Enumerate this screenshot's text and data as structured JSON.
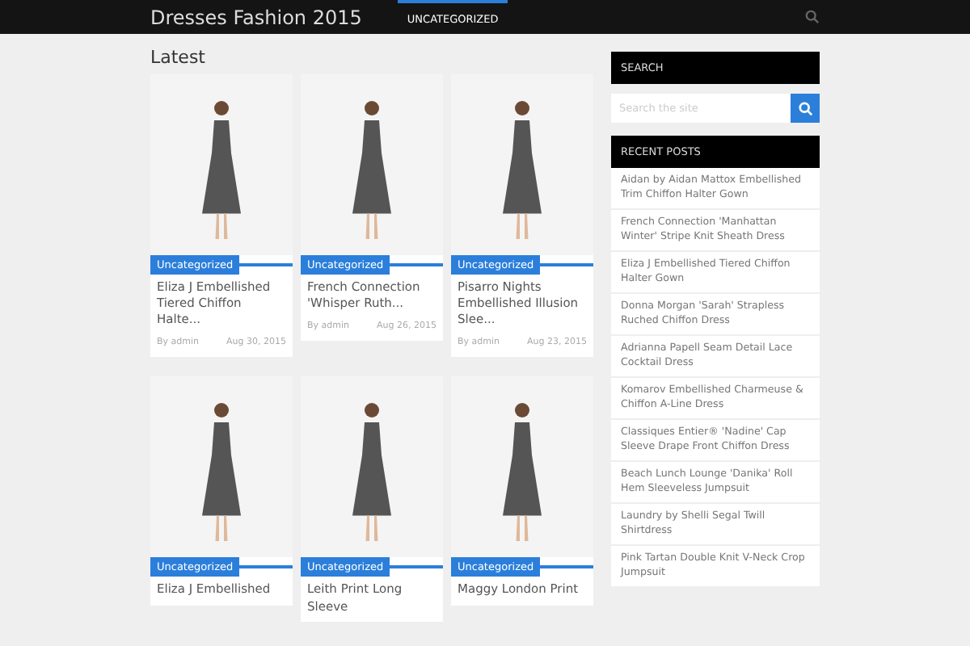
{
  "header": {
    "site_title": "Dresses Fashion 2015",
    "nav": [
      {
        "label": "UNCATEGORIZED",
        "selected": true
      }
    ]
  },
  "section_title": "Latest",
  "posts": [
    {
      "category": "Uncategorized",
      "title": "Eliza J Embellished Tiered Chiffon Halte...",
      "author": "By admin",
      "date": "Aug 30, 2015"
    },
    {
      "category": "Uncategorized",
      "title": "French Connection 'Whisper Ruth...",
      "author": "By admin",
      "date": "Aug 26, 2015"
    },
    {
      "category": "Uncategorized",
      "title": "Pisarro Nights Embellished Illusion Slee...",
      "author": "By admin",
      "date": "Aug 23, 2015"
    },
    {
      "category": "Uncategorized",
      "title": "Eliza J Embellished"
    },
    {
      "category": "Uncategorized",
      "title": "Leith Print Long Sleeve"
    },
    {
      "category": "Uncategorized",
      "title": "Maggy London Print"
    }
  ],
  "sidebar": {
    "search_heading": "SEARCH",
    "search": {
      "placeholder": "Search the site"
    },
    "recent_heading": "RECENT POSTS",
    "recent_posts": [
      "Aidan by Aidan Mattox Embellished Trim Chiffon Halter Gown",
      "French Connection 'Manhattan Winter' Stripe Knit Sheath Dress",
      "Eliza J Embellished Tiered Chiffon Halter Gown",
      "Donna Morgan 'Sarah' Strapless Ruched Chiffon Dress",
      "Adrianna Papell Seam Detail Lace Cocktail Dress",
      "Komarov Embellished Charmeuse & Chiffon A-Line Dress",
      "Classiques Entier® 'Nadine' Cap Sleeve Drape Front Chiffon Dress",
      "Beach Lunch Lounge 'Danika' Roll Hem Sleeveless Jumpsuit",
      "Laundry by Shelli Segal Twill Shirtdress",
      "Pink Tartan Double Knit V-Neck Crop Jumpsuit"
    ]
  }
}
